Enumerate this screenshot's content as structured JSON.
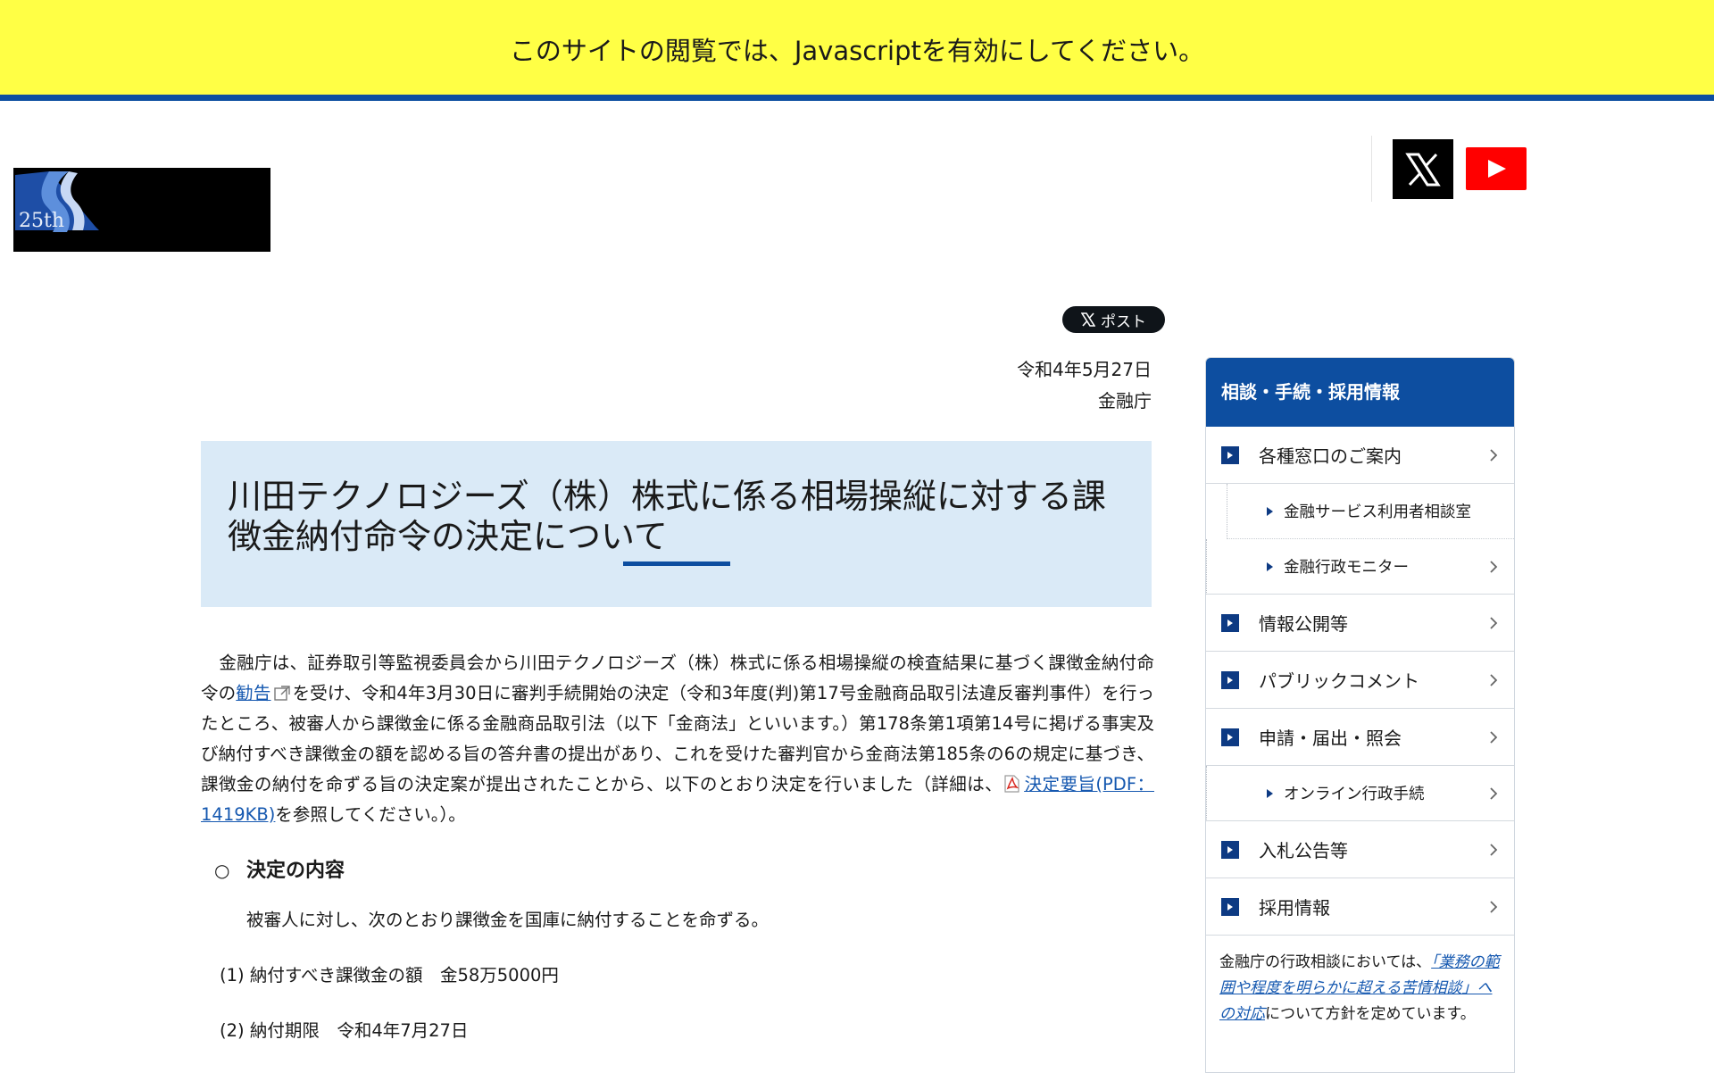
{
  "banner": {
    "text": "このサイトの閲覧では、Javascriptを有効にしてください。"
  },
  "header": {
    "logo_badge": "25th"
  },
  "share": {
    "post_label": "ポスト"
  },
  "article": {
    "date": "令和4年5月27日",
    "issuer": "金融庁",
    "title": "川田テクノロジーズ（株）株式に係る相場操縦に対する課徴金納付命令の決定について",
    "para_part1": "金融庁は、証券取引等監視委員会から川田テクノロジーズ（株）株式に係る相場操縦の検査結果に基づく課徴金納付命令の",
    "para_link1": "勧告",
    "para_part2": "を受け、令和4年3月30日に審判手続開始の決定（令和3年度(判)第17号金融商品取引法違反審判事件）を行ったところ、被審人から課徴金に係る金融商品取引法（以下「金商法」といいます。）第178条第1項第14号に掲げる事実及び納付すべき課徴金の額を認める旨の答弁書の提出があり、これを受けた審判官から金商法第185条の6の規定に基づき、課徴金の納付を命ずる旨の決定案が提出されたことから、以下のとおり決定を行いました（詳細は、",
    "para_link2": "決定要旨(PDF：1419KB)",
    "para_part3": "を参照してください。）。",
    "section_bullet": "○",
    "section_title": "決定の内容",
    "order_text": "被審人に対し、次のとおり課徴金を国庫に納付することを命ずる。",
    "item1": "(1) 納付すべき課徴金の額　金58万5000円",
    "item2": "(2) 納付期限　令和4年7月27日"
  },
  "sidebar": {
    "heading": "相談・手続・採用情報",
    "items": [
      {
        "label": "各種窓口のご案内"
      },
      {
        "label": "金融サービス利用者相談室"
      },
      {
        "label": "金融行政モニター"
      },
      {
        "label": "情報公開等"
      },
      {
        "label": "パブリックコメント"
      },
      {
        "label": "申請・届出・照会"
      },
      {
        "label": "オンライン行政手続"
      },
      {
        "label": "入札公告等"
      },
      {
        "label": "採用情報"
      }
    ],
    "note_part1": "金融庁の行政相談においては、",
    "note_link": "「業務の範囲や程度を明らかに超える苦情相談」への対応",
    "note_part2": "について方針を定めています。"
  },
  "colors": {
    "accent": "#0d4ea0",
    "banner": "#ffff45",
    "title_bg": "#daeaf7",
    "link": "#1558b0"
  },
  "icons": [
    "x-logo-icon",
    "youtube-icon",
    "external-link-icon",
    "pdf-icon",
    "chevron-right-icon"
  ]
}
